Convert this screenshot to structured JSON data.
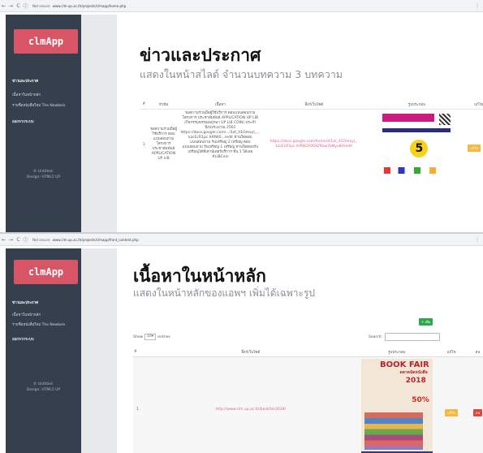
{
  "screen1": {
    "url": "www.clm.up.ac.th/projects/clmapp/home.php",
    "security": "Not secure",
    "app_title": "clmApp",
    "menu": [
      {
        "label": "ข่าวและประกาศ"
      },
      {
        "label": "เนื้อหาในหน้าหลัก"
      },
      {
        "label": "รายชื่อหนังสือใหม่ The Newbeis"
      },
      {
        "label": "ออกจากระบบ"
      }
    ],
    "footer": [
      "© Untitled.",
      "Design: HTML5 UP"
    ],
    "page_title": "ข่าวและประกาศ",
    "page_subtitle": "แสดงในหน้าสไลด์ จำนวนบทความ 3 บทความ",
    "table": {
      "headers": [
        "#",
        "หัวข้อ",
        "เนื้อหา",
        "ลิ้งก์เว็บไซต์",
        "รูปประกอบ",
        "แก้ไข"
      ],
      "rows": [
        {
          "num": "1",
          "topic": "ขอความร่วมมือผู้ใช้บริการ ตอบแบบสอบถาม โครงการ ประชาสัมพันธ์ APPLICATION UP LIB",
          "content": "ขอความร่วมมือผู้ใช้บริการ ตอบแบบสอบถาม โครงการ ประชาสัมพันธ์ APPLICATION UP LIB (กิจกรรมพรรณพฤกษา UP LIB COIN) ประจำปีงบประมาณ 2561 https://docs.google.com/.../1zt_it1Omxyl_... kzcEcR1pc.lHRW0.../edit ท่านใดตอบแบบสอบถาม รับเหรียญ 2 เหรียญ ตอบแบบสอบถาม รับเหรียญ 1 เหรียญ ท่านใดตอบรับเหรียญได้ที่เคาน์เตอร์บริการ ชั้น 1 ได้เลย #LIBCoin",
          "link": "https://docs.google.com/forms/d/1zt_it1Omxyl_-kzcEcR1pc.lHRW2tOOGfRow7bNyu8H/edit",
          "image_label": "poster-survey",
          "edit_label": "แก้ไข"
        }
      ]
    }
  },
  "screen2": {
    "url": "www.clm.up.ac.th/projects/clmapp/front_content.php",
    "security": "Not secure",
    "app_title": "clmApp",
    "menu": [
      {
        "label": "ข่าวและประกาศ"
      },
      {
        "label": "เนื้อหาในหน้าหลัก"
      },
      {
        "label": "รายชื่อหนังสือใหม่ The Newbeis"
      },
      {
        "label": "ออกจากระบบ"
      }
    ],
    "footer": [
      "© Untitled.",
      "Design: HTML5 UP"
    ],
    "page_title": "เนื้อหาในหน้าหลัก",
    "page_subtitle": "แสดงในหน้าหลักของแอพฯ เพิ่มได้เฉพาะรูป",
    "add_button": "+ เพิ่ม",
    "show_label": "Show",
    "entries_value": "10",
    "entries_label": "entries",
    "search_label": "Search:",
    "search_value": "",
    "table": {
      "headers": [
        "#",
        "ลิ้งก์เว็บไซต์",
        "รูปประกอบ",
        "แก้ไข",
        "ลบ"
      ],
      "rows": [
        {
          "num": "1",
          "link": "http://www.clm.up.ac.th/bookfair2018/",
          "poster_title": "BOOK FAIR",
          "poster_sub": "ตลาดนัดหนังสือ",
          "poster_year": "2018",
          "poster_discount": "50%",
          "edit_label": "แก้ไข",
          "delete_label": "ลบ"
        }
      ]
    }
  },
  "colors": {
    "sidebar": "#363f4e",
    "logo": "#d85566",
    "link": "#e0647a",
    "edit": "#f5b942",
    "delete": "#e0473f",
    "add": "#2ba84a"
  }
}
